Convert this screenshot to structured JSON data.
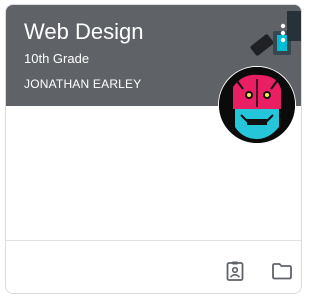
{
  "card": {
    "title": "Web Design",
    "section": "10th Grade",
    "teacher": "JONATHAN EARLEY"
  },
  "icons": {
    "more": "more-vert-icon",
    "work": "assignment-ind-icon",
    "folder": "folder-icon"
  },
  "colors": {
    "header": "#5f6368",
    "text": "#ffffff",
    "icon": "#5f6368"
  }
}
